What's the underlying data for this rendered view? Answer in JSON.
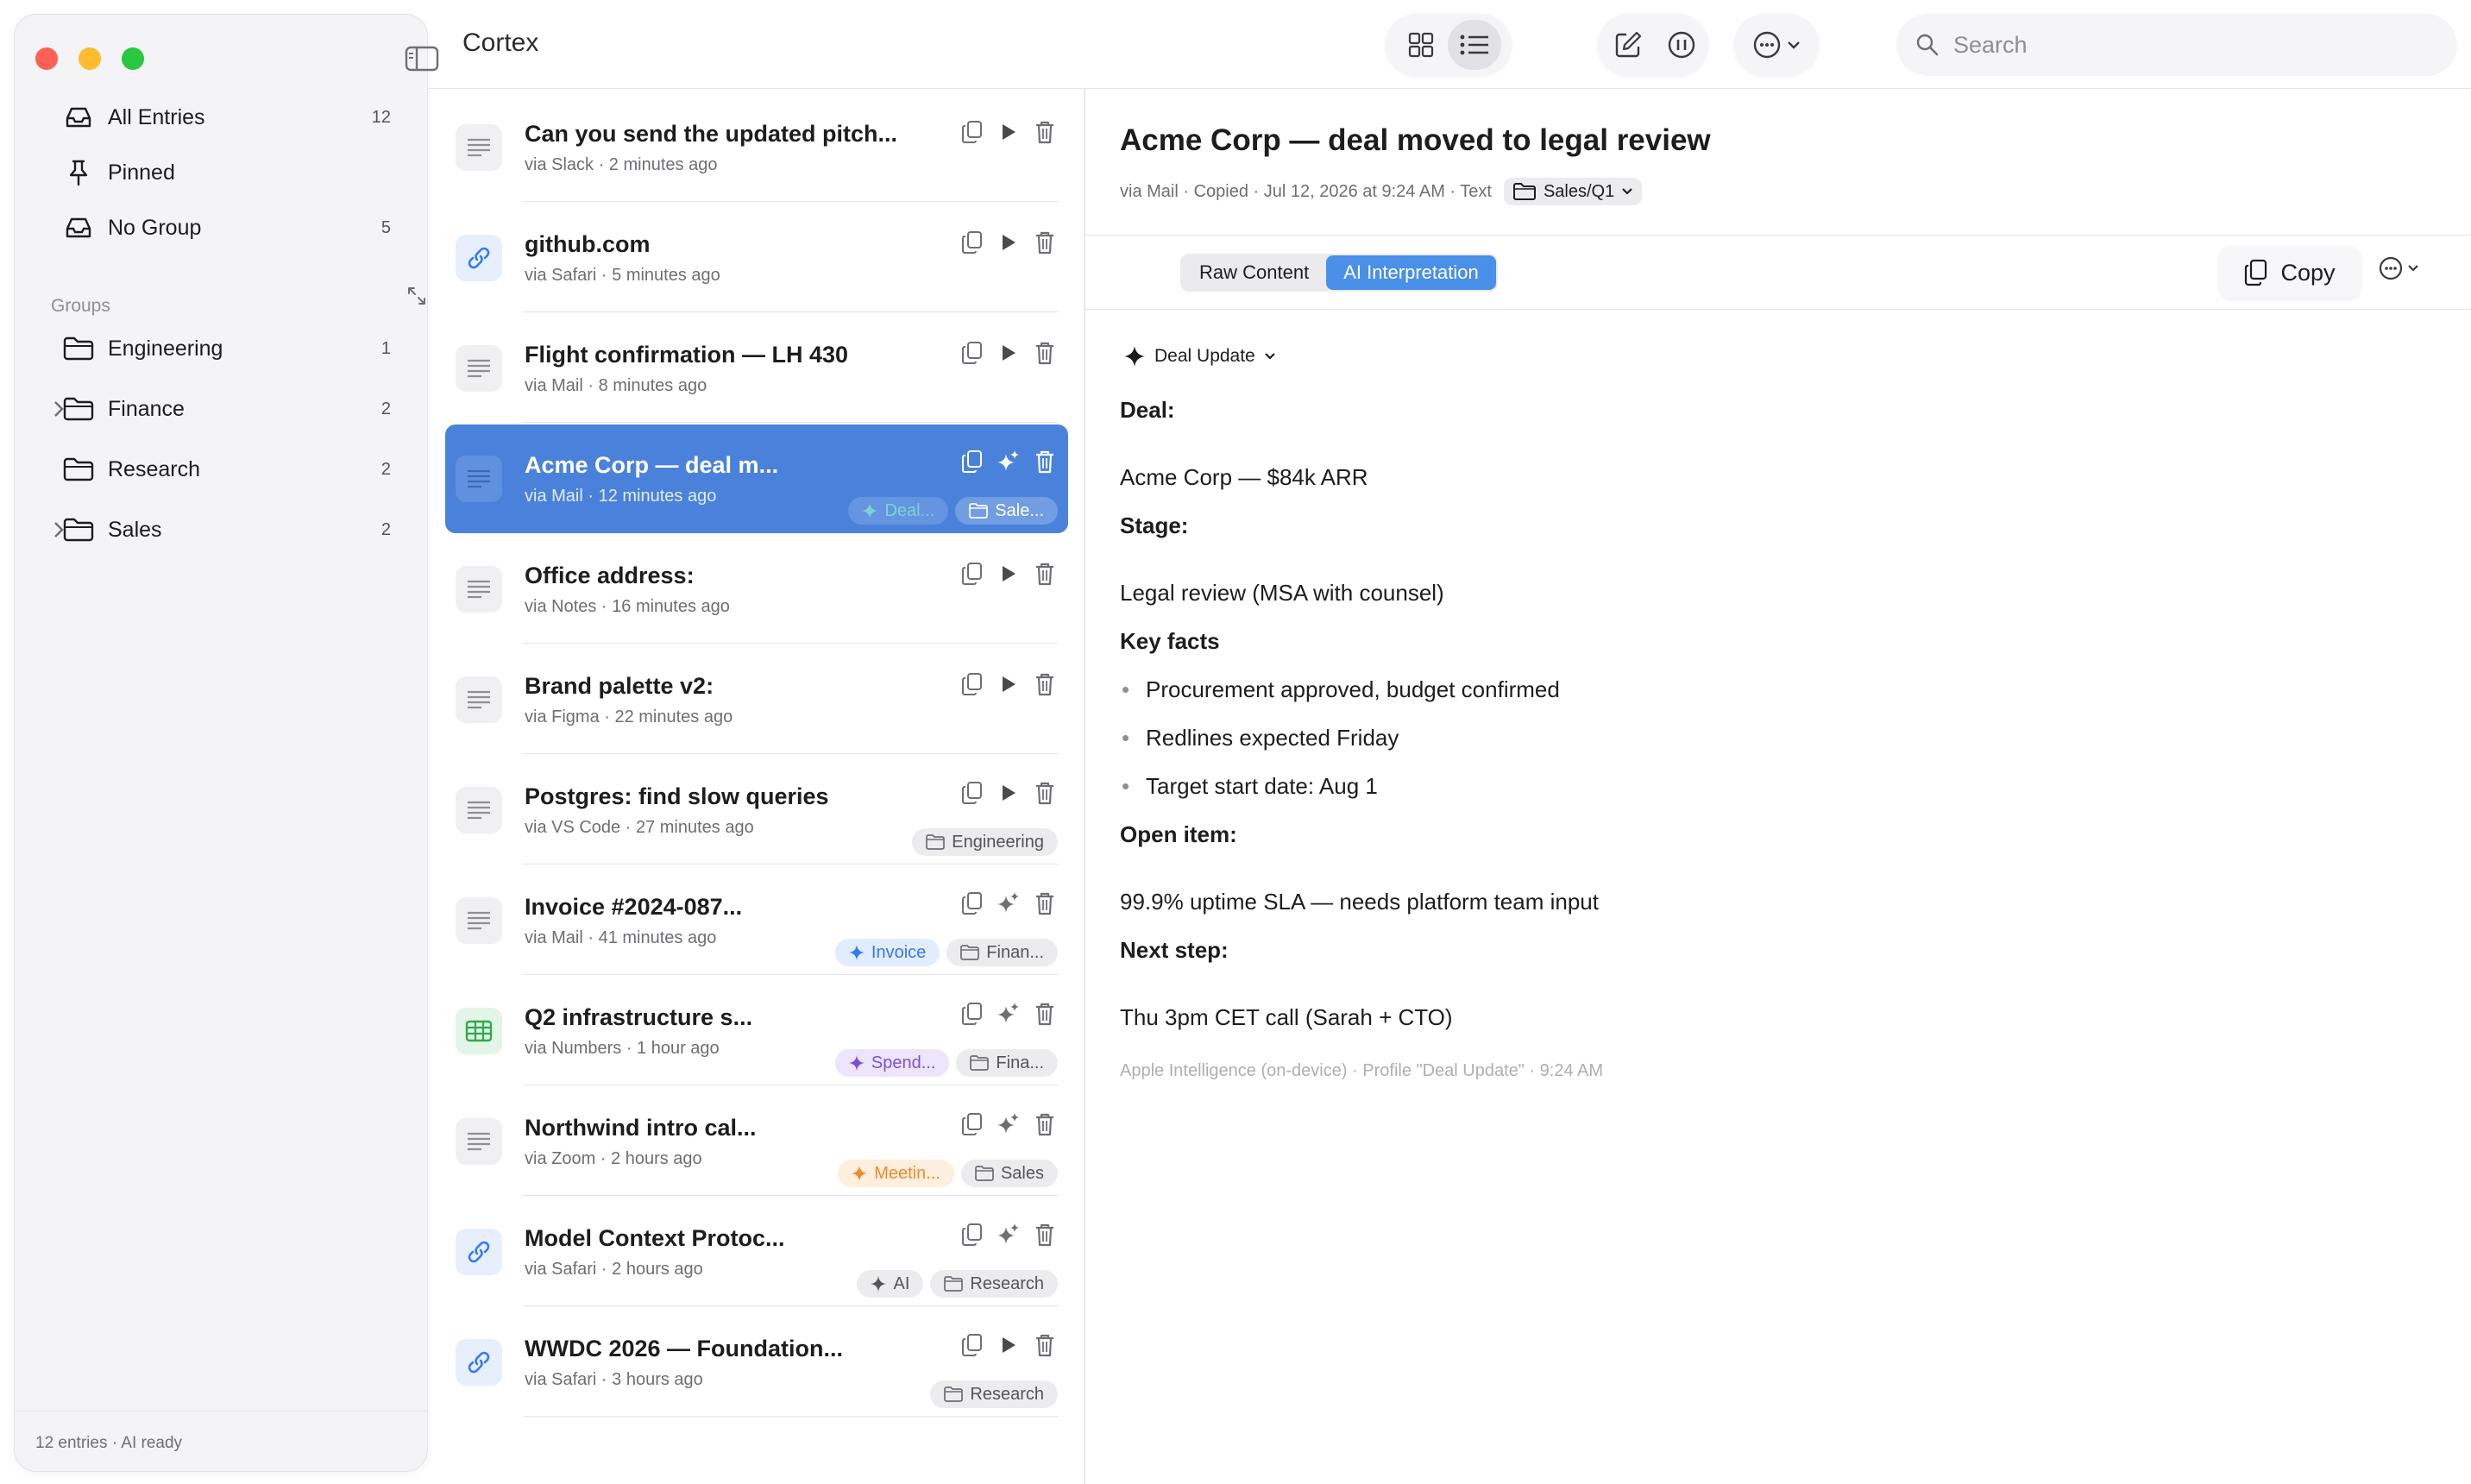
{
  "app": {
    "title": "Cortex"
  },
  "sidebar": {
    "nav": [
      {
        "label": "All Entries",
        "count": "12"
      },
      {
        "label": "Pinned",
        "count": ""
      },
      {
        "label": "No Group",
        "count": "5"
      }
    ],
    "groups_heading": "Groups",
    "groups": [
      {
        "label": "Engineering",
        "count": "1",
        "expandable": false
      },
      {
        "label": "Finance",
        "count": "2",
        "expandable": true
      },
      {
        "label": "Research",
        "count": "2",
        "expandable": false
      },
      {
        "label": "Sales",
        "count": "2",
        "expandable": true
      }
    ],
    "footer": "12 entries · AI ready"
  },
  "toolbar": {
    "search_placeholder": "Search"
  },
  "entries": [
    {
      "title": "Can you send the updated pitch...",
      "sub": "via Slack · 2 minutes ago",
      "icon": "text-icon",
      "ai": false,
      "tags": []
    },
    {
      "title": "github.com",
      "sub": "via Safari · 5 minutes ago",
      "icon": "link-icon",
      "ai": false,
      "tags": []
    },
    {
      "title": "Flight confirmation — LH 430",
      "sub": "via Mail · 8 minutes ago",
      "icon": "text-icon",
      "ai": false,
      "tags": []
    },
    {
      "title": "Acme Corp — deal m...",
      "sub": "via Mail · 12 minutes ago",
      "icon": "text-icon",
      "ai": true,
      "selected": true,
      "tags": [
        {
          "label": "Deal...",
          "kind": "ai",
          "color": "#79d6cf"
        },
        {
          "label": "Sale...",
          "kind": "folder"
        }
      ]
    },
    {
      "title": "Office address:",
      "sub": "via Notes · 16 minutes ago",
      "icon": "text-icon",
      "ai": false,
      "tags": []
    },
    {
      "title": "Brand palette v2:",
      "sub": "via Figma · 22 minutes ago",
      "icon": "text-icon",
      "ai": false,
      "tags": []
    },
    {
      "title": "Postgres: find slow queries",
      "sub": "via VS Code · 27 minutes ago",
      "icon": "text-icon",
      "ai": false,
      "tags": [
        {
          "label": "Engineering",
          "kind": "folder"
        }
      ]
    },
    {
      "title": "Invoice #2024-087...",
      "sub": "via Mail · 41 minutes ago",
      "icon": "text-icon",
      "ai": true,
      "tags": [
        {
          "label": "Invoice",
          "kind": "ai",
          "color": "#3478f6",
          "bg": "#e1ecfd"
        },
        {
          "label": "Finan...",
          "kind": "folder"
        }
      ]
    },
    {
      "title": "Q2 infrastructure s...",
      "sub": "via Numbers · 1 hour ago",
      "icon": "table-icon",
      "ai": true,
      "tags": [
        {
          "label": "Spend...",
          "kind": "ai",
          "color": "#7d4fd8",
          "bg": "#ece5fb"
        },
        {
          "label": "Fina...",
          "kind": "folder"
        }
      ]
    },
    {
      "title": "Northwind intro cal...",
      "sub": "via Zoom · 2 hours ago",
      "icon": "text-icon",
      "ai": true,
      "tags": [
        {
          "label": "Meetin...",
          "kind": "ai",
          "color": "#f08a2c",
          "bg": "#fdeedd"
        },
        {
          "label": "Sales",
          "kind": "folder"
        }
      ]
    },
    {
      "title": "Model Context Protoc...",
      "sub": "via Safari · 2 hours ago",
      "icon": "link-icon",
      "ai": true,
      "tags": [
        {
          "label": "AI",
          "kind": "ai",
          "color": "#555555",
          "bg": "#ececef"
        },
        {
          "label": "Research",
          "kind": "folder"
        }
      ]
    },
    {
      "title": "WWDC 2026 — Foundation...",
      "sub": "via Safari · 3 hours ago",
      "icon": "link-icon",
      "ai": false,
      "tags": [
        {
          "label": "Research",
          "kind": "folder"
        }
      ]
    }
  ],
  "detail": {
    "title": "Acme Corp — deal moved to legal review",
    "meta": "via Mail · Copied · Jul 12, 2026 at 9:24 AM · Text",
    "folder": "Sales/Q1",
    "tabs": [
      "Raw Content",
      "AI Interpretation"
    ],
    "copy_label": "Copy",
    "profile": "Deal Update",
    "lines": [
      {
        "type": "heading",
        "text": "Deal:"
      },
      {
        "type": "text",
        "text": "Acme Corp — $84k ARR"
      },
      {
        "type": "heading",
        "text": "Stage:"
      },
      {
        "type": "text",
        "text": "Legal review (MSA with counsel)"
      },
      {
        "type": "heading",
        "text": "Key facts"
      },
      {
        "type": "bullet",
        "text": "Procurement approved, budget confirmed"
      },
      {
        "type": "bullet",
        "text": "Redlines expected Friday"
      },
      {
        "type": "bullet",
        "text": "Target start date: Aug 1"
      },
      {
        "type": "heading",
        "text": "Open item:"
      },
      {
        "type": "text",
        "text": "99.9% uptime SLA — needs platform team input"
      },
      {
        "type": "heading",
        "text": "Next step:"
      },
      {
        "type": "text",
        "text": "Thu 3pm CET call (Sarah + CTO)"
      }
    ],
    "footnote": "Apple Intelligence (on-device) · Profile \"Deal Update\" · 9:24 AM"
  },
  "colors": {
    "accent": "#4a82db",
    "close": "#fe5f57",
    "minimize": "#febc2e",
    "zoom": "#28c840"
  }
}
